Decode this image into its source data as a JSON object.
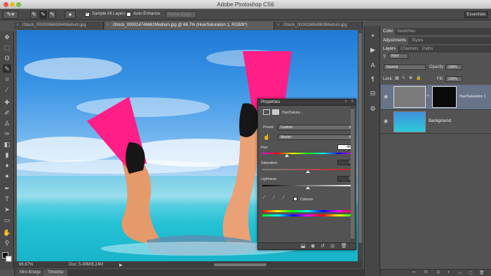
{
  "window": {
    "title": "Adobe Photoshop CS6"
  },
  "options_bar": {
    "sample_all_layers_label": "Sample All Layers",
    "sample_all_layers_checked": true,
    "auto_enhance_label": "Auto-Enhance",
    "auto_enhance_checked": false,
    "refine_edge_label": "Refine Edge...",
    "workspace_label": "Essentials"
  },
  "document_tabs": [
    {
      "label": "iStock_000009666594Medium.jpg",
      "active": false
    },
    {
      "label": "iStock_000014746662Medium.jpg @ 66.7% (Hue/Saturation 1, RGB/8*)",
      "active": true
    },
    {
      "label": "iStock_000028654863Medium.jpg",
      "active": false
    }
  ],
  "status_bar": {
    "zoom": "66.67%",
    "doc_size": "Doc: 5.49M/6.24M"
  },
  "bottom_tabs": [
    "Mini Bridge",
    "Timeline"
  ],
  "right_panel": {
    "color_tabs": [
      "Color",
      "Swatches"
    ],
    "adjust_tabs": [
      "Adjustments",
      "Styles"
    ],
    "layer_tabs": [
      "Layers",
      "Channels",
      "Paths"
    ],
    "kind_filter": "Kind",
    "blend_mode": "Normal",
    "opacity_label": "Opacity:",
    "opacity_value": "100%",
    "lock_label": "Lock:",
    "fill_label": "Fill:",
    "fill_value": "100%",
    "layers": [
      {
        "name": "Hue/Saturation 1",
        "selected": true
      },
      {
        "name": "Background",
        "selected": false
      }
    ]
  },
  "properties": {
    "panel_title": "Properties",
    "adjustment_name": "Hue/Satura...",
    "preset_label": "Preset:",
    "preset_value": "Custom",
    "channel_value": "Master",
    "hue_label": "Hue:",
    "hue_value": "-84",
    "hue_position": 0.27,
    "saturation_label": "Saturation:",
    "saturation_value": "0",
    "saturation_position": 0.5,
    "lightness_label": "Lightness:",
    "lightness_value": "0",
    "lightness_position": 0.5,
    "colorize_label": "Colorize",
    "colorize_checked": false
  },
  "tools": [
    "move-tool",
    "marquee-tool",
    "lasso-tool",
    "quick-selection-tool",
    "crop-tool",
    "eyedropper-tool",
    "spot-healing-tool",
    "brush-tool",
    "clone-stamp-tool",
    "history-brush-tool",
    "eraser-tool",
    "gradient-tool",
    "blur-tool",
    "dodge-tool",
    "pen-tool",
    "type-tool",
    "path-selection-tool",
    "shape-tool",
    "hand-tool",
    "zoom-tool"
  ]
}
